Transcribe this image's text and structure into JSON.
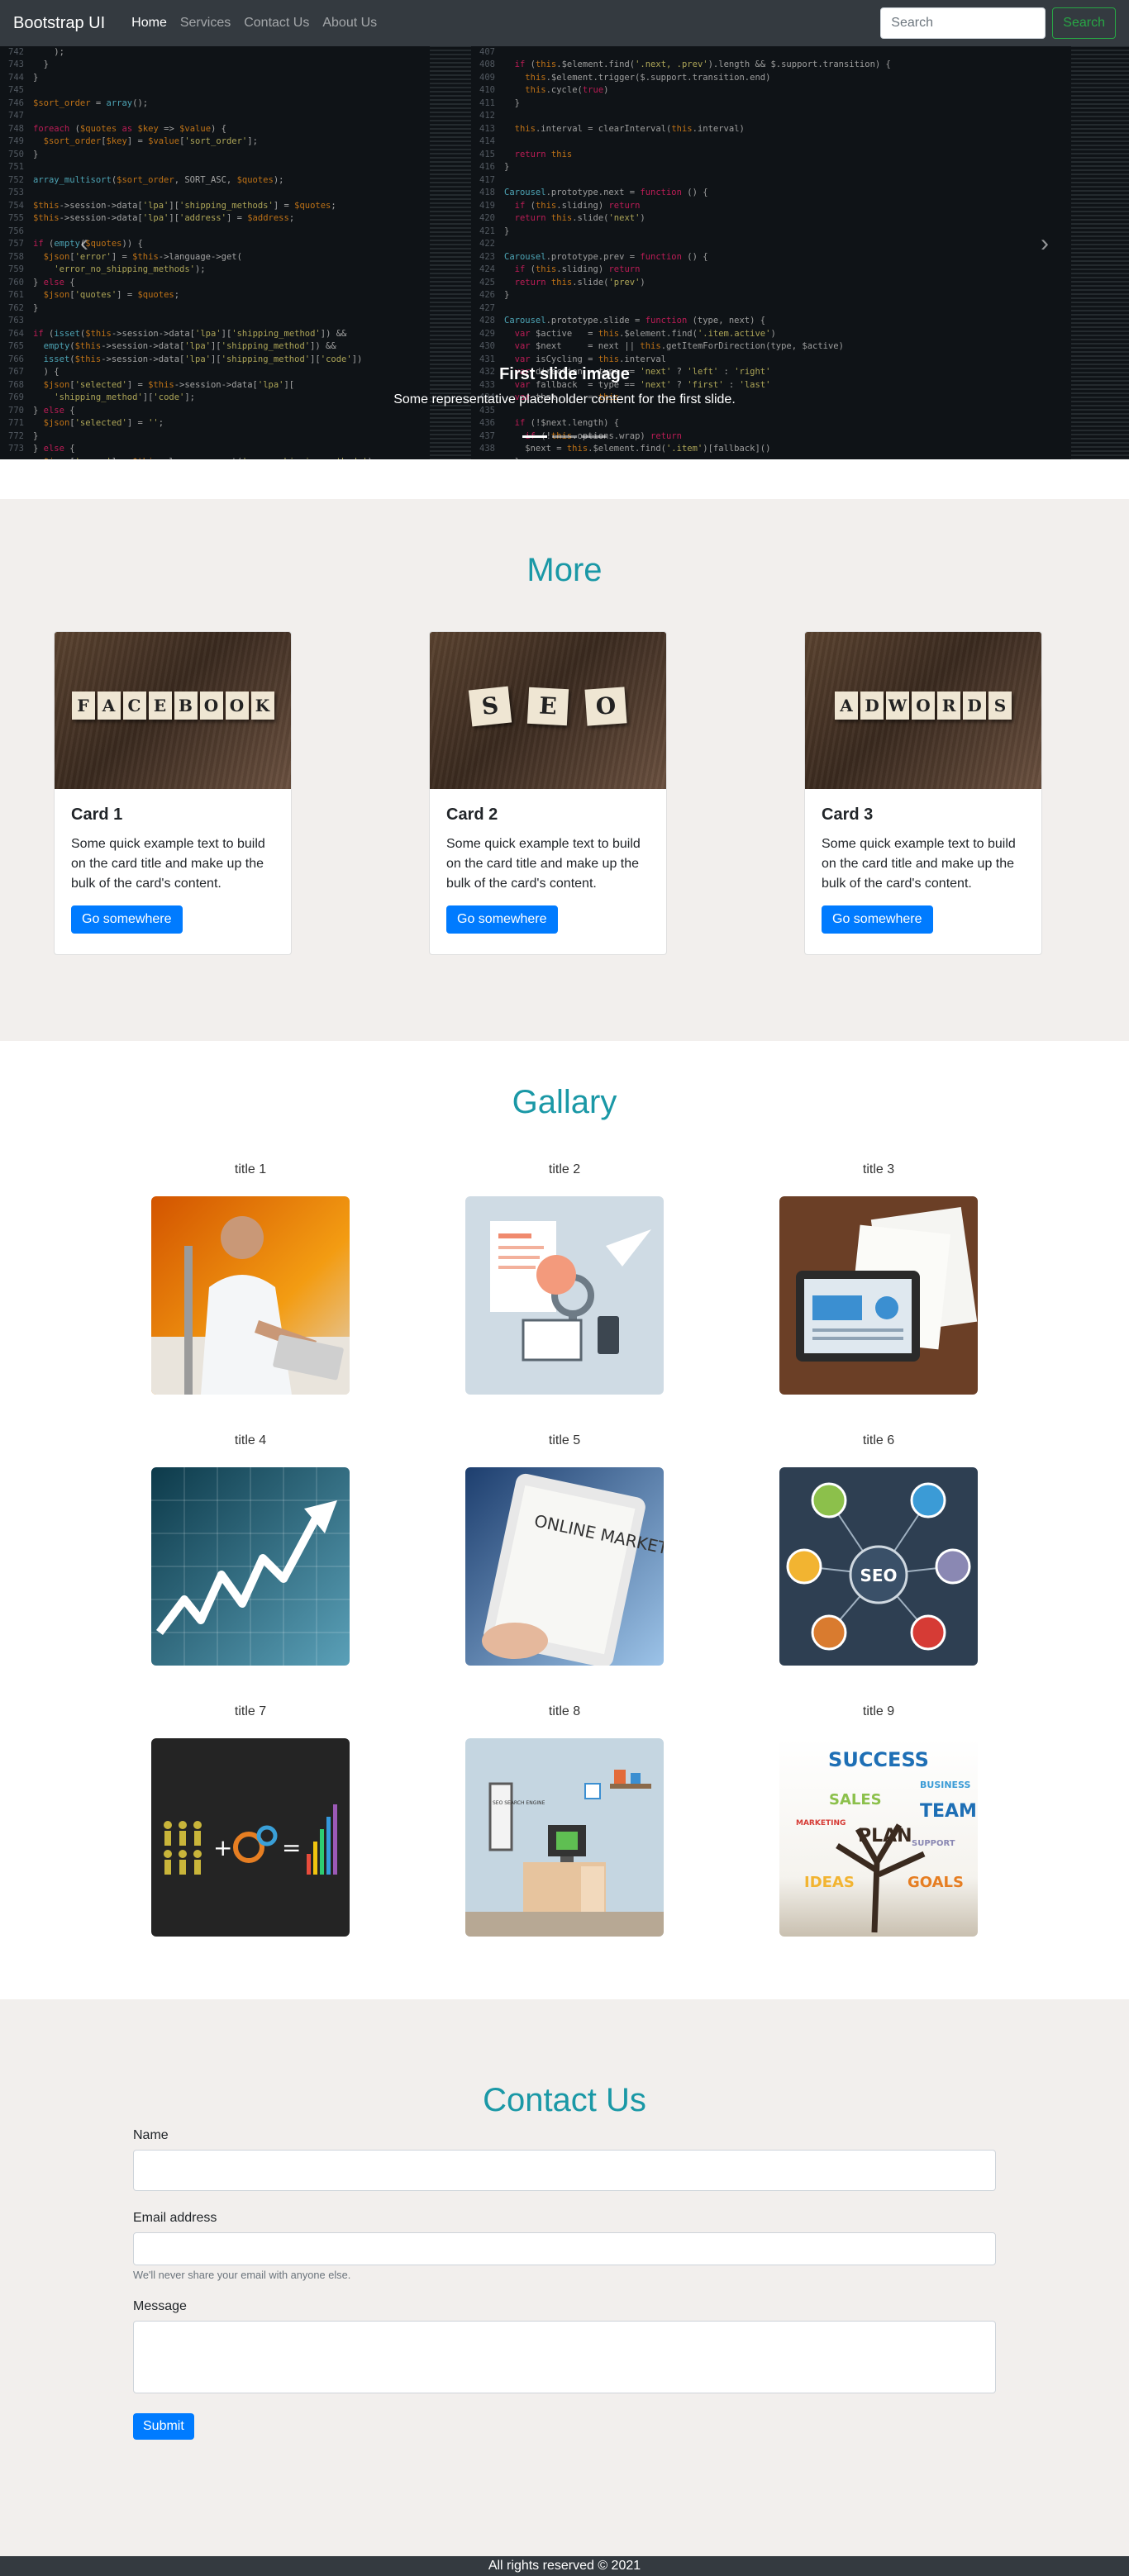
{
  "navbar": {
    "brand": "Bootstrap UI",
    "links": [
      "Home",
      "Services",
      "Contact Us",
      "About Us"
    ],
    "search_placeholder": "Search",
    "search_button": "Search"
  },
  "carousel": {
    "caption_title": "First slide image",
    "caption_text": "Some representative placeholder content for the first slide.",
    "slide_count": 3,
    "active_slide": 1,
    "prev_icon": "chevron-left-icon",
    "next_icon": "chevron-right-icon"
  },
  "more": {
    "title": "More",
    "cards": [
      {
        "title": "Card 1",
        "text": "Some quick example text to build on the card title and make up the bulk of the card's content.",
        "button": "Go somewhere",
        "image_word": "FACEBOOK"
      },
      {
        "title": "Card 2",
        "text": "Some quick example text to build on the card title and make up the bulk of the card's content.",
        "button": "Go somewhere",
        "image_word": "SEO"
      },
      {
        "title": "Card 3",
        "text": "Some quick example text to build on the card title and make up the bulk of the card's content.",
        "button": "Go somewhere",
        "image_word": "ADWORDS"
      }
    ]
  },
  "gallery": {
    "title": "Gallary",
    "items": [
      {
        "label": "title 1"
      },
      {
        "label": "title 2"
      },
      {
        "label": "title 3"
      },
      {
        "label": "title 4"
      },
      {
        "label": "title 5"
      },
      {
        "label": "title 6"
      },
      {
        "label": "title 7"
      },
      {
        "label": "title 8"
      },
      {
        "label": "title 9"
      }
    ],
    "image_text": {
      "online_marketing": "ONLINE MARKETING",
      "seo": "SEO",
      "seo_poster": "SEO SEARCH ENGINE",
      "success": "SUCCESS",
      "tree_words": [
        "SALES",
        "TEAM",
        "PLAN",
        "IDEAS",
        "GOALS",
        "BUSINESS",
        "MARKETING",
        "SUPPORT"
      ]
    }
  },
  "contact": {
    "title": "Contact Us",
    "name_label": "Name",
    "email_label": "Email address",
    "email_help": "We'll never share your email with anyone else.",
    "message_label": "Message",
    "submit": "Submit"
  },
  "footer": {
    "text": "All rights reserved © 2021"
  },
  "colors": {
    "navbar_bg": "#343a40",
    "accent_title": "#1a98a6",
    "primary": "#007bff",
    "success": "#28a745",
    "section_bg": "#f2efed"
  }
}
